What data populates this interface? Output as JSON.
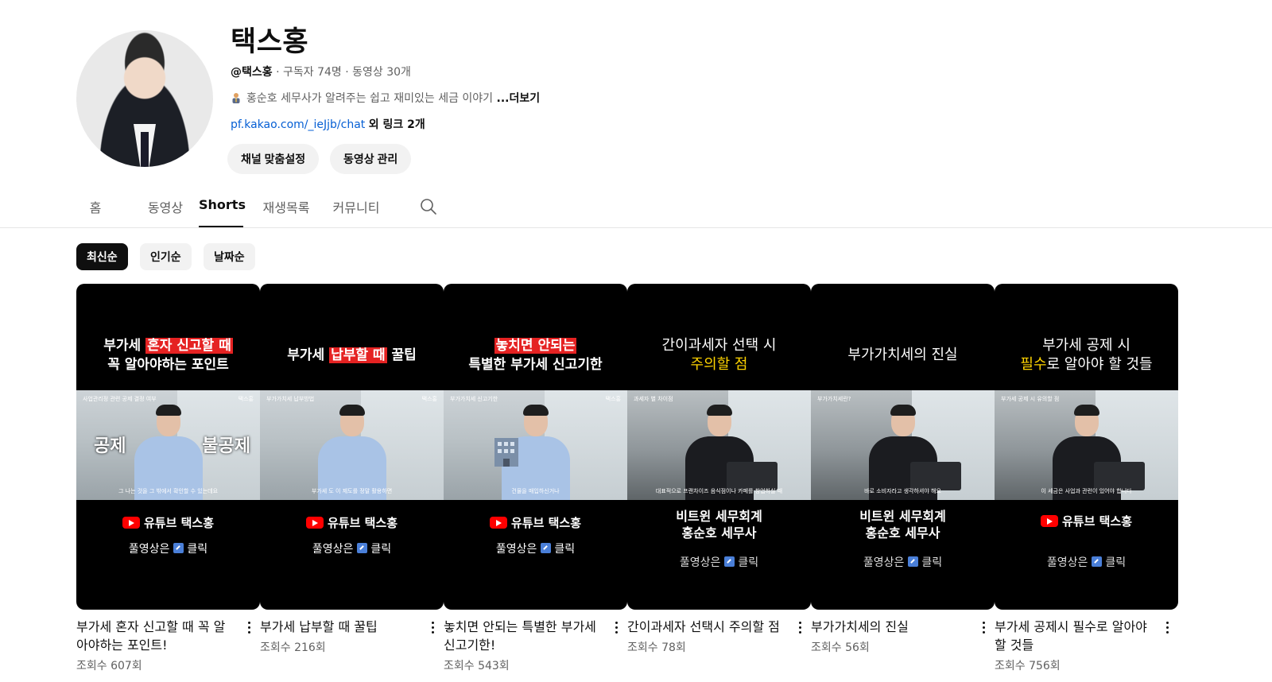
{
  "channel": {
    "name": "택스홍",
    "handle": "@택스홍",
    "subscribers": "구독자 74명",
    "videos": "동영상 30개",
    "separator": "·",
    "description": "홍순호 세무사가 알려주는 쉽고 재미있는 세금 이야기",
    "more_label": "...더보기",
    "link_text": "pf.kakao.com/_ieJjb/chat",
    "link_extra": "외 링크 2개",
    "customize_button": "채널 맞춤설정",
    "manage_button": "동영상 관리"
  },
  "tabs": [
    {
      "label": "홈"
    },
    {
      "label": "동영상"
    },
    {
      "label": "Shorts",
      "active": true
    },
    {
      "label": "재생목록"
    },
    {
      "label": "커뮤니티"
    }
  ],
  "filters": [
    {
      "label": "최신순",
      "active": true
    },
    {
      "label": "인기순"
    },
    {
      "label": "날짜순"
    }
  ],
  "shorts": [
    {
      "title": "부가세 혼자 신고할 때 꼭 알아야하는 포인트!",
      "views": "조회수 607회",
      "thumb_line1_a": "부가세 ",
      "thumb_line1_b": "혼자 신고할 때",
      "thumb_line2": "꼭 알아야하는 포인트",
      "frame_tag": "사업관리정 관련 공제 결정 여부",
      "frame_brand": "택스홍",
      "frame_left": "공제",
      "frame_right": "불공제",
      "frame_caption": "그 나는 것을 그 밖에서 확인할 수 있는데요",
      "bottom_line1": "유튜브 택스홍",
      "bottom_line2": "풀영상은",
      "bottom_line2_end": "클릭"
    },
    {
      "title": "부가세 납부할 때 꿀팁",
      "views": "조회수 216회",
      "thumb_line1_a": "부가세 ",
      "thumb_line1_b": "납부할 때",
      "thumb_line1_c": " 꿀팁",
      "frame_tag": "부가가치세 납부방법",
      "frame_brand": "택스홍",
      "frame_caption": "부가세 도 이 제도를 정말 활용하면",
      "bottom_line1": "유튜브 택스홍",
      "bottom_line2": "풀영상은",
      "bottom_line2_end": "클릭"
    },
    {
      "title": "놓치면 안되는 특별한 부가세 신고기한!",
      "views": "조회수 543회",
      "thumb_line1_b": "놓치면 안되는",
      "thumb_line2": "특별한 부가세 신고기한",
      "frame_tag": "부가가치세 신고기한",
      "frame_brand": "택스홍",
      "frame_caption": "건물을 매입하신거나",
      "bottom_line1": "유튜브 택스홍",
      "bottom_line2": "풀영상은",
      "bottom_line2_end": "클릭"
    },
    {
      "title": "간이과세자 선택시 주의할 점",
      "views": "조회수 78회",
      "thumb_line1": "간이과세자 선택 시",
      "thumb_line2": "주의할 점",
      "frame_tag": "과세자 별 차이점",
      "frame_caption": "대표적으로 프랜차이즈 음식점이나 카페를 창업하실 때",
      "firm_line1": "비트윈 세무회계",
      "firm_line2": "홍순호 세무사",
      "bottom_line2": "풀영상은",
      "bottom_line2_end": "클릭"
    },
    {
      "title": "부가가치세의 진실",
      "views": "조회수 56회",
      "thumb_line1": "부가가치세의 진실",
      "frame_tag": "부가가치세란?",
      "frame_caption": "바로 소비자라고 생각하셔야 해요",
      "firm_line1": "비트윈 세무회계",
      "firm_line2": "홍순호 세무사",
      "bottom_line2": "풀영상은",
      "bottom_line2_end": "클릭"
    },
    {
      "title": "부가세 공제시 필수로 알아야할 것들",
      "views": "조회수 756회",
      "thumb_line1": "부가세 공제 시",
      "thumb_line2_a": "필수",
      "thumb_line2_b": "로 알아야 할 것들",
      "frame_tag": "부가세 공제 시 유의할 점",
      "frame_caption": "이 세금은 사업과 관련이 있어야 합니다",
      "bottom_line1": "유튜브 택스홍",
      "bottom_line2": "풀영상은",
      "bottom_line2_end": "클릭"
    }
  ],
  "colors": {
    "accent_link": "#065fd4",
    "highlight_red": "#e52222",
    "highlight_yellow": "#ffd400",
    "youtube_red": "#ff0000"
  }
}
